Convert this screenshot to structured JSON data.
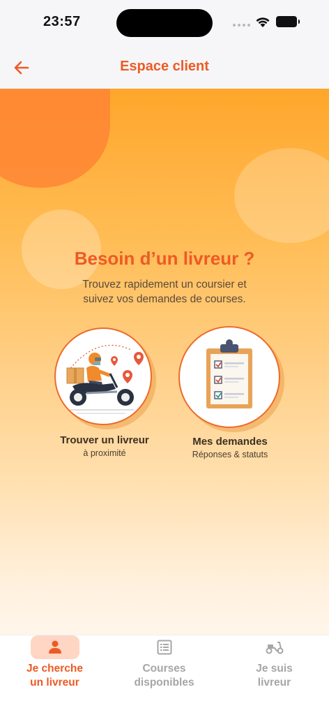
{
  "status_bar": {
    "time": "23:57"
  },
  "nav": {
    "title": "Espace client"
  },
  "hero": {
    "headline": "Besoin d’un livreur ?",
    "subtitle_line1": "Trouvez rapidement un coursier et",
    "subtitle_line2": "suivez vos demandes de courses."
  },
  "cards": [
    {
      "title": "Trouver un livreur",
      "subtitle": "à proximité",
      "icon": "delivery-motorbike-icon"
    },
    {
      "title": "Mes demandes",
      "subtitle": "Réponses & statuts",
      "icon": "clipboard-checklist-icon"
    }
  ],
  "tabs": [
    {
      "line1": "Je cherche",
      "line2": "un livreur",
      "icon": "person-icon",
      "active": true
    },
    {
      "line1": "Courses",
      "line2": "disponibles",
      "icon": "list-icon",
      "active": false
    },
    {
      "line1": "Je suis",
      "line2": "livreur",
      "icon": "scooter-icon",
      "active": false
    }
  ],
  "colors": {
    "accent": "#ee5a24",
    "active_tab_bg": "#ffd6c3",
    "inactive": "#a6a6a6"
  }
}
